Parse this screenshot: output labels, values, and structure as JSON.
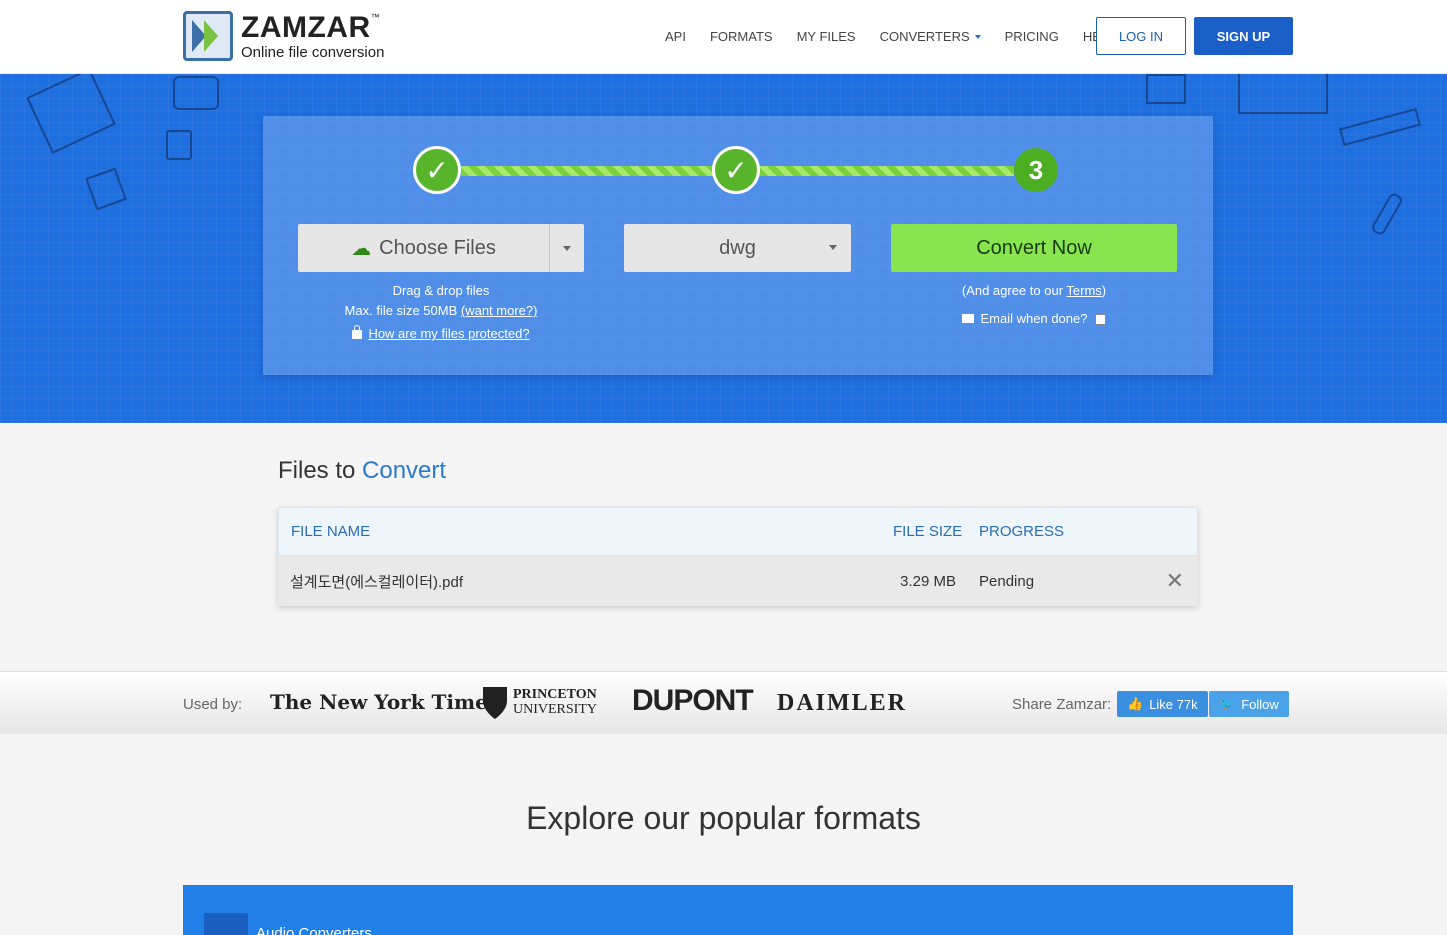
{
  "header": {
    "brand_name": "ZAMZAR",
    "brand_tm": "™",
    "tagline": "Online file conversion",
    "nav": [
      "API",
      "FORMATS",
      "MY FILES",
      "CONVERTERS",
      "PRICING",
      "HELP"
    ],
    "login_label": "LOG IN",
    "signup_label": "SIGN UP"
  },
  "converter": {
    "step1": "✓",
    "step2": "✓",
    "step3": "3",
    "choose_files_label": "Choose Files",
    "format_value": "dwg",
    "convert_label": "Convert Now",
    "drag_drop": "Drag & drop files",
    "max_size": "Max. file size 50MB",
    "want_more": "(want more?)",
    "protected_link": "How are my files protected?",
    "agree_prefix": "(And agree to our ",
    "terms_link": "Terms",
    "agree_suffix": ")",
    "email_label": "Email when done?"
  },
  "files": {
    "title_prefix": "Files to",
    "title_accent": "Convert",
    "columns": {
      "name": "FILE NAME",
      "size": "FILE SIZE",
      "progress": "PROGRESS"
    },
    "rows": [
      {
        "name": "설계도면(에스컬레이터).pdf",
        "size": "3.29 MB",
        "progress": "Pending"
      }
    ]
  },
  "used_by": {
    "label": "Used by:",
    "brands": [
      "The New York Times",
      "PRINCETON",
      "UNIVERSITY",
      "DUPONT",
      "DAIMLER"
    ],
    "share_label": "Share Zamzar:",
    "like_label": "Like 77k",
    "follow_label": "Follow"
  },
  "explore": {
    "title": "Explore our popular formats",
    "first_category": "Audio Converters"
  },
  "colors": {
    "hero_blue": "#1e6fe0",
    "convert_green": "#88e550",
    "step_green": "#58b42a",
    "signup_blue": "#1a5fc8",
    "accent_blue": "#2a7ad2"
  }
}
